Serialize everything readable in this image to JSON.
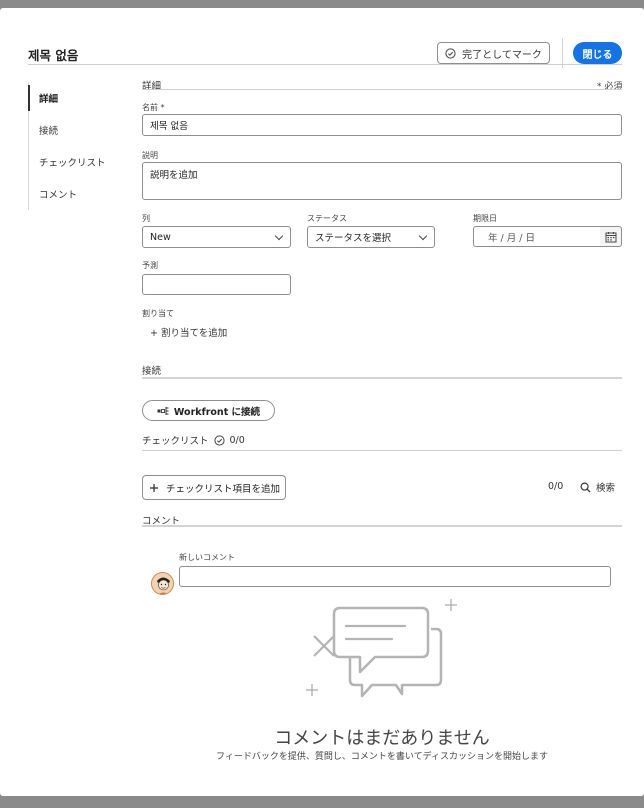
{
  "header": {
    "title": "제목 없음",
    "mark_complete_label": "完了としてマーク",
    "close_label": "閉じる"
  },
  "nav": {
    "items": [
      "詳細",
      "接続",
      "チェックリスト",
      "コメント"
    ],
    "active_index": 0
  },
  "details": {
    "section_title": "詳細",
    "required_note": "* 必須",
    "name_label": "名前 *",
    "name_value": "제목 없음",
    "description_label": "説明",
    "description_value": "説明を追加",
    "column_label": "列",
    "column_value": "New",
    "status_label": "ステータス",
    "status_value": "ステータスを選択",
    "due_date_label": "期限日",
    "due_date_placeholder": "年 / 月 / 日",
    "estimate_label": "予測",
    "estimate_value": "",
    "assignment_label": "割り当て",
    "add_assignment_label": "+ 割り当てを追加"
  },
  "connections": {
    "section_title": "接続",
    "connect_label": "Workfront に接続"
  },
  "checklist": {
    "section_title": "チェックリスト",
    "progress": "0/0",
    "add_item_label": "チェックリスト項目を追加",
    "count": "0/0",
    "search_label": "検索"
  },
  "comments": {
    "section_title": "コメント",
    "new_comment_label": "新しいコメント",
    "new_comment_value": "",
    "empty_title": "コメントはまだありません",
    "empty_description": "フィードバックを提供、質問し、コメントを書いてディスカッションを開始します"
  },
  "colors": {
    "accent": "#1473e6",
    "backdrop": "#8a8a8a",
    "border": "#8e8e8e"
  }
}
